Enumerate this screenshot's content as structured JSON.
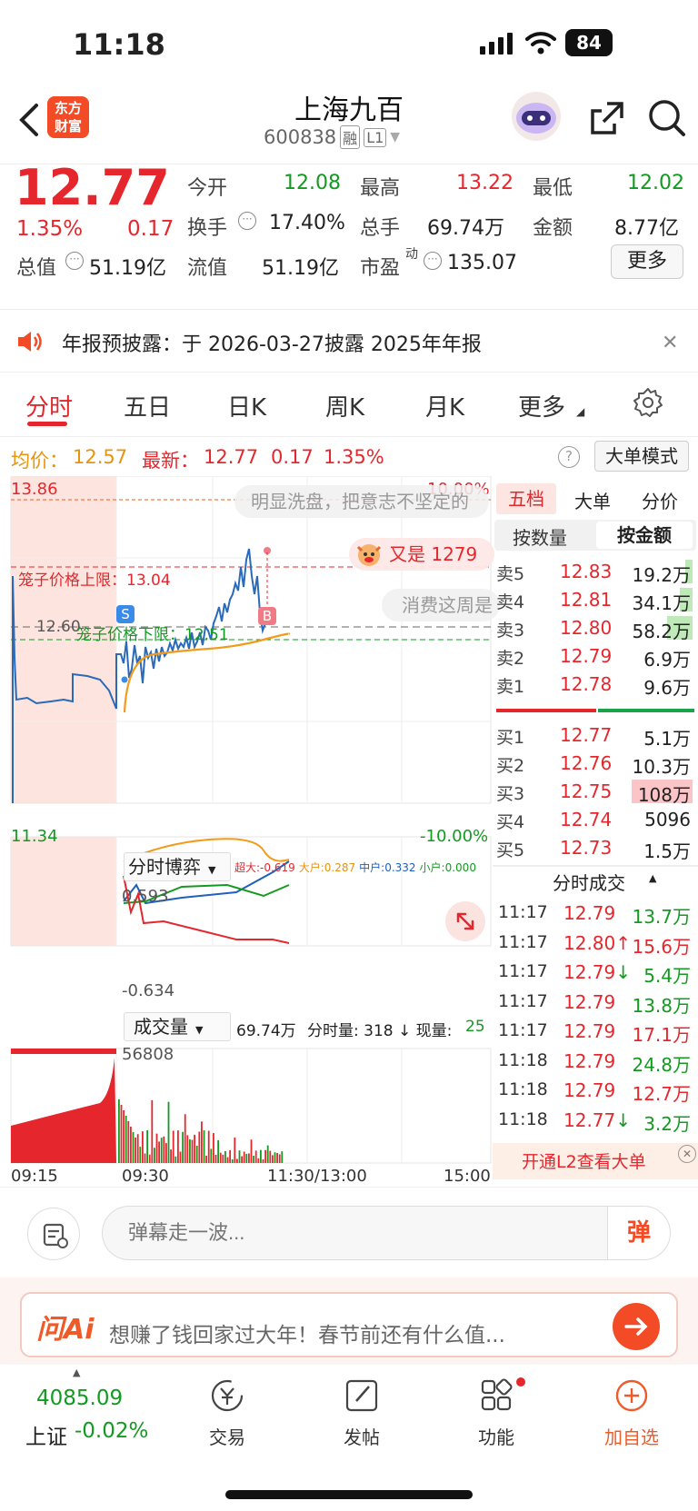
{
  "status": {
    "time": "11:18",
    "battery": "84"
  },
  "header": {
    "brand_line1": "东方",
    "brand_line2": "财富",
    "title": "上海九百",
    "code": "600838",
    "badge1": "融",
    "badge2": "L1"
  },
  "quote": {
    "price": "12.77",
    "pct": "1.35%",
    "chg": "0.17",
    "open_label": "今开",
    "open": "12.08",
    "high_label": "最高",
    "high": "13.22",
    "low_label": "最低",
    "low": "12.02",
    "turnover_label": "换手",
    "turnover": "17.40%",
    "volume_label": "总手",
    "volume": "69.74万",
    "amount_label": "金额",
    "amount": "8.77亿",
    "mktcap_label": "总值",
    "mktcap": "51.19亿",
    "float_label": "流值",
    "float": "51.19亿",
    "pe_label": "市盈",
    "pe_sup": "动",
    "pe": "135.07",
    "more_button": "更多"
  },
  "notice": {
    "text": "年报预披露：于 2026-03-27披露 2025年年报"
  },
  "tabs": [
    "分时",
    "五日",
    "日K",
    "周K",
    "月K",
    "更多"
  ],
  "pricebar": {
    "avg_label": "均价：",
    "avg": "12.57",
    "latest_label": "最新：",
    "latest": "12.77",
    "chg": "0.17",
    "pct": "1.35%",
    "mode_button": "大单模式"
  },
  "chart": {
    "top_price": "13.86",
    "bottom_price": "11.34",
    "top_pct": "10.00%",
    "bottom_pct": "-10.00%",
    "mid_price": "12.60",
    "upper_limit_label": "笼子价格上限：13.04",
    "lower_limit_label": "笼子价格下限：12.51",
    "danmu1": "明显洗盘，把意志不坚定的",
    "danmu2": "又是 1279",
    "danmu3": "消费这周是",
    "sell_marker": "S",
    "buy_marker": "B",
    "sub_title": "分时博弈",
    "sub_legend": [
      {
        "label": "超大:",
        "value": "-0.619",
        "color": "#e5272d"
      },
      {
        "label": "大户:",
        "value": "0.287",
        "color": "#e8930e"
      },
      {
        "label": "中户:",
        "value": "0.332",
        "color": "#1f5fbf"
      },
      {
        "label": "小户:",
        "value": "0.000",
        "color": "#139a21"
      }
    ],
    "sub_top": "0.593",
    "sub_bottom": "-0.634",
    "vol_title": "成交量",
    "vol_total": "69.74万",
    "vol_info": "分时量: 318 ↓ 现量:",
    "vol_now": "25",
    "vol_max": "56808",
    "time_labels": [
      "09:15",
      "09:30",
      "11:30/13:00",
      "15:00"
    ]
  },
  "orderbook": {
    "tabs": [
      "五档",
      "大单",
      "分价"
    ],
    "subtabs": [
      "按数量",
      "按金额"
    ],
    "asks": [
      {
        "label": "卖5",
        "price": "12.83",
        "vol": "19.2万",
        "bar": 0.12
      },
      {
        "label": "卖4",
        "price": "12.81",
        "vol": "34.1万",
        "bar": 0.2
      },
      {
        "label": "卖3",
        "price": "12.80",
        "vol": "58.2万",
        "bar": 0.4
      },
      {
        "label": "卖2",
        "price": "12.79",
        "vol": "6.9万",
        "bar": 0
      },
      {
        "label": "卖1",
        "price": "12.78",
        "vol": "9.6万",
        "bar": 0
      }
    ],
    "bids": [
      {
        "label": "买1",
        "price": "12.77",
        "vol": "5.1万",
        "bar": 0
      },
      {
        "label": "买2",
        "price": "12.76",
        "vol": "10.3万",
        "bar": 0
      },
      {
        "label": "买3",
        "price": "12.75",
        "vol": "108万",
        "bar": 0.95
      },
      {
        "label": "买4",
        "price": "12.74",
        "vol": "5096",
        "bar": 0
      },
      {
        "label": "买5",
        "price": "12.73",
        "vol": "1.5万",
        "bar": 0
      }
    ],
    "ticks_title": "分时成交",
    "ticks": [
      {
        "time": "11:17",
        "price": "12.79",
        "arrow": "",
        "vol": "13.7万",
        "dir": "g"
      },
      {
        "time": "11:17",
        "price": "12.80",
        "arrow": "↑",
        "vol": "15.6万",
        "dir": "r"
      },
      {
        "time": "11:17",
        "price": "12.79",
        "arrow": "↓",
        "vol": "5.4万",
        "dir": "g"
      },
      {
        "time": "11:17",
        "price": "12.79",
        "arrow": "",
        "vol": "13.8万",
        "dir": "g"
      },
      {
        "time": "11:17",
        "price": "12.79",
        "arrow": "",
        "vol": "17.1万",
        "dir": "r"
      },
      {
        "time": "11:18",
        "price": "12.79",
        "arrow": "",
        "vol": "24.8万",
        "dir": "g"
      },
      {
        "time": "11:18",
        "price": "12.79",
        "arrow": "",
        "vol": "12.7万",
        "dir": "r"
      },
      {
        "time": "11:18",
        "price": "12.77",
        "arrow": "↓",
        "vol": "3.2万",
        "dir": "g"
      }
    ],
    "l2_banner": "开通L2查看大单"
  },
  "comment": {
    "placeholder": "弹幕走一波...",
    "danmu_button": "弹"
  },
  "ai": {
    "logo": "问Ai",
    "prompt": "想赚了钱回家过大年！春节前还有什么值..."
  },
  "tabbar": {
    "index_value": "4085.09",
    "index_name": "上证",
    "index_chg": "-0.02%",
    "items": [
      "交易",
      "发帖",
      "功能",
      "加自选"
    ]
  },
  "colors": {
    "up": "#e5272d",
    "down": "#139a21",
    "accent": "#ff6a1a"
  }
}
